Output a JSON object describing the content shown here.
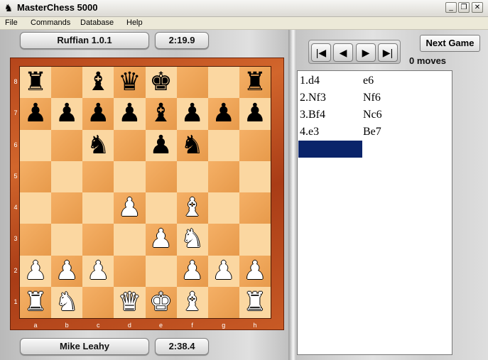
{
  "window": {
    "title": "MasterChess 5000"
  },
  "menu": {
    "file": "File",
    "commands": "Commands",
    "database": "Database",
    "help": "Help"
  },
  "top_player": {
    "name": "Ruffian 1.0.1",
    "clock": "2:19.9"
  },
  "bottom_player": {
    "name": "Mike Leahy",
    "clock": "2:38.4"
  },
  "nav": {
    "first": "first-move-icon",
    "prev": "previous-move-icon",
    "next": "next-move-icon",
    "last": "last-move-icon"
  },
  "next_game_label": "Next Game",
  "move_count": "0 moves",
  "board": {
    "ranks": [
      "8",
      "7",
      "6",
      "5",
      "4",
      "3",
      "2",
      "1"
    ],
    "files": [
      "a",
      "b",
      "c",
      "d",
      "e",
      "f",
      "g",
      "h"
    ],
    "rows": [
      [
        "bR",
        "",
        "bB",
        "bQ",
        "bK",
        "",
        "",
        "bR"
      ],
      [
        "bP",
        "bP",
        "bP",
        "bP",
        "bB",
        "bP",
        "bP",
        "bP"
      ],
      [
        "",
        "",
        "bN",
        "",
        "bP",
        "bN",
        "",
        ""
      ],
      [
        "",
        "",
        "",
        "",
        "",
        "",
        "",
        ""
      ],
      [
        "",
        "",
        "",
        "wP",
        "",
        "wB",
        "",
        ""
      ],
      [
        "",
        "",
        "",
        "",
        "wP",
        "wN",
        "",
        ""
      ],
      [
        "wP",
        "wP",
        "wP",
        "",
        "",
        "wP",
        "wP",
        "wP"
      ],
      [
        "wR",
        "wN",
        "",
        "wQ",
        "wK",
        "wB",
        "",
        "wR"
      ]
    ]
  },
  "moves": [
    {
      "white": "1.d4",
      "black": "e6"
    },
    {
      "white": "2.Nf3",
      "black": "Nf6"
    },
    {
      "white": "3.Bf4",
      "black": "Nc6"
    },
    {
      "white": "4.e3",
      "black": "Be7"
    }
  ]
}
